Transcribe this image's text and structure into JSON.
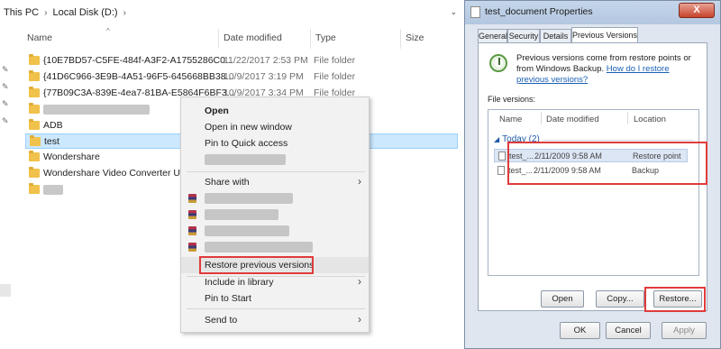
{
  "explorer": {
    "breadcrumb": [
      "This PC",
      "Local Disk (D:)"
    ],
    "columns": {
      "name": "Name",
      "date": "Date modified",
      "type": "Type",
      "size": "Size"
    },
    "rows": [
      {
        "name": "{10E7BD57-C5FE-484f-A3F2-A1755286C0...",
        "date": "11/22/2017 2:53 PM",
        "type": "File folder"
      },
      {
        "name": "{41D6C966-3E9B-4A51-96F5-645668BB38...",
        "date": "10/9/2017 3:19 PM",
        "type": "File folder"
      },
      {
        "name": "{77B09C3A-839E-4ea7-81BA-E5864F6BF3...",
        "date": "10/9/2017 3:34 PM",
        "type": "File folder"
      },
      {
        "name": "ADB"
      },
      {
        "name": "test"
      },
      {
        "name": "Wondershare"
      },
      {
        "name": "Wondershare Video Converter Ulti"
      }
    ]
  },
  "context_menu": {
    "open": "Open",
    "open_new_window": "Open in new window",
    "pin_quick_access": "Pin to Quick access",
    "share_with": "Share with",
    "restore_previous": "Restore previous versions",
    "include_library": "Include in library",
    "pin_start": "Pin to Start",
    "send_to": "Send to"
  },
  "dialog": {
    "title": "test_document Properties",
    "close": "X",
    "tabs": [
      "General",
      "Security",
      "Details",
      "Previous Versions"
    ],
    "description": "Previous versions come from restore points or from Windows Backup.",
    "help_link": "How do I restore previous versions?",
    "file_versions_label": "File versions:",
    "list_headers": {
      "name": "Name",
      "date": "Date modified",
      "location": "Location"
    },
    "group": "Today (2)",
    "versions": [
      {
        "name": "test_...",
        "date": "2/11/2009 9:58 AM",
        "location": "Restore point"
      },
      {
        "name": "test_...",
        "date": "2/11/2009 9:58 AM",
        "location": "Backup"
      }
    ],
    "buttons": {
      "open": "Open",
      "copy": "Copy...",
      "restore": "Restore...",
      "ok": "OK",
      "cancel": "Cancel",
      "apply": "Apply"
    }
  },
  "colors": {
    "highlight_box": "#e03b3b",
    "selection": "#cce8ff",
    "link": "#1a5fb4"
  }
}
